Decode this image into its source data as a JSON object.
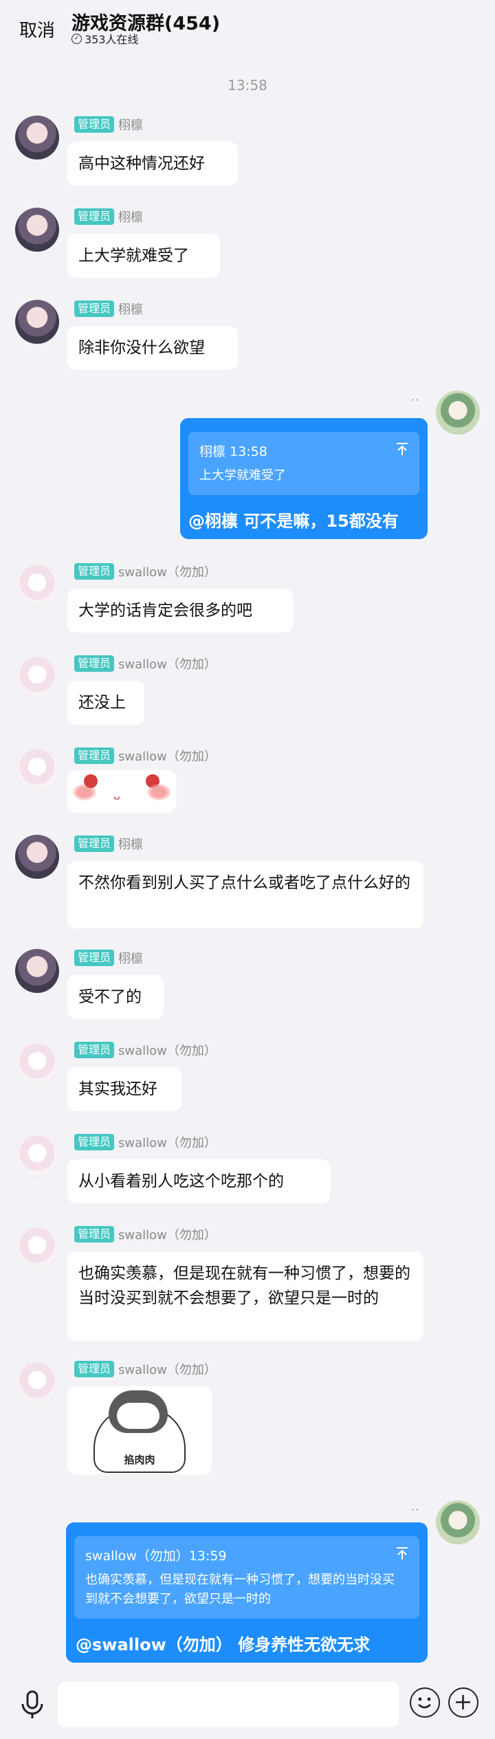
{
  "header": {
    "cancel_label": "取消",
    "title": "游戏资源群(454)",
    "online_text": "353人在线"
  },
  "timestamp": "13:58",
  "messages": [
    {
      "badge": "管理员",
      "name": "栩檩",
      "text": "高中这种情况还好"
    },
    {
      "badge": "管理员",
      "name": "栩檩",
      "text": "上大学就难受了"
    },
    {
      "badge": "管理员",
      "name": "栩檩",
      "text": "除非你没什么欲望"
    },
    {
      "badge": "管理员",
      "name": "swallow（勿加）",
      "text": "大学的话肯定会很多的吧"
    },
    {
      "badge": "管理员",
      "name": "swallow（勿加）",
      "text": "还没上"
    },
    {
      "badge": "管理员",
      "name": "swallow（勿加）",
      "text": ""
    },
    {
      "badge": "管理员",
      "name": "栩檩",
      "text": "不然你看到别人买了点什么或者吃了点什么好的"
    },
    {
      "badge": "管理员",
      "name": "栩檩",
      "text": "受不了的"
    },
    {
      "badge": "管理员",
      "name": "swallow（勿加）",
      "text": "其实我还好"
    },
    {
      "badge": "管理员",
      "name": "swallow（勿加）",
      "text": "从小看着别人吃这个吃那个的"
    },
    {
      "badge": "管理员",
      "name": "swallow（勿加）",
      "text": "也确实羡慕，但是现在就有一种习惯了，想要的当时没买到就不会想要了，欲望只是一时的"
    },
    {
      "badge": "管理员",
      "name": "swallow（勿加）",
      "text": "",
      "sticker_text": "掐肉肉"
    }
  ],
  "self_messages": [
    {
      "quote_author": "栩檩 13:58",
      "quote_text": "上大学就难受了",
      "text": "@栩檩 可不是嘛，15都没有",
      "dots": "··"
    },
    {
      "quote_author": "swallow（勿加）13:59",
      "quote_text": "也确实羡慕，但是现在就有一种习惯了，想要的当时没买到就不会想要了，欲望只是一时的",
      "text": "@swallow（勿加） 修身养性无欲无求",
      "dots": "··"
    }
  ],
  "colors": {
    "background": "#f3f3f7",
    "admin_badge": "#46c7c1",
    "self_bubble": "#1d8dfc",
    "quote_box": "#4aa4ff"
  }
}
